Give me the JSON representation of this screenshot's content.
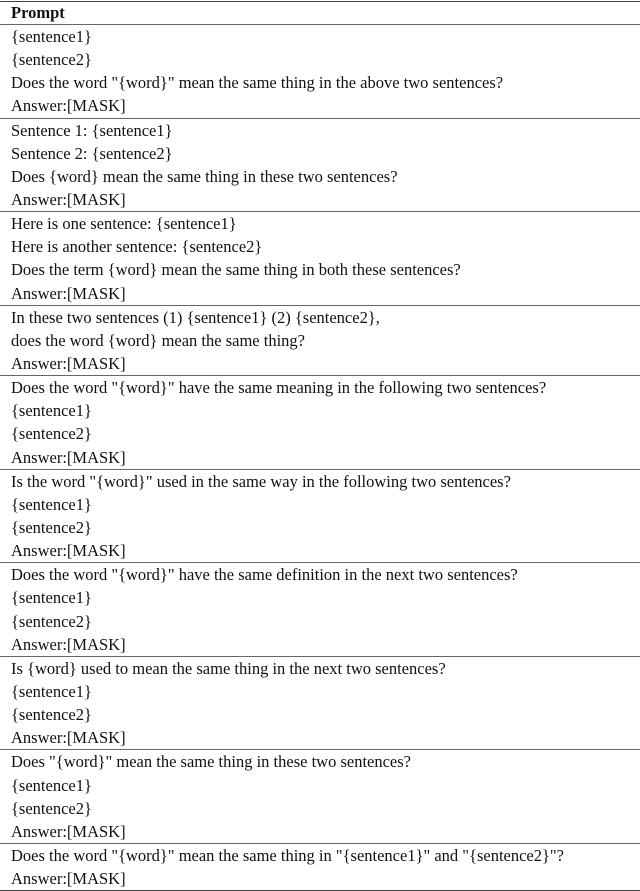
{
  "table": {
    "header": "Prompt",
    "groups": [
      {
        "lines": [
          "{sentence1}",
          "{sentence2}",
          "Does the word \"{word}\" mean the same thing in the above two sentences?",
          "Answer:[MASK]"
        ]
      },
      {
        "lines": [
          "Sentence 1: {sentence1}",
          "Sentence 2: {sentence2}",
          "Does {word} mean the same thing in these two sentences?",
          "Answer:[MASK]"
        ]
      },
      {
        "lines": [
          "Here is one sentence: {sentence1}",
          "Here is another sentence: {sentence2}",
          "Does the term {word} mean the same thing in both these sentences?",
          "Answer:[MASK]"
        ]
      },
      {
        "lines": [
          "In these two sentences (1) {sentence1} (2) {sentence2},",
          "does the word {word} mean the same thing?",
          "Answer:[MASK]"
        ]
      },
      {
        "lines": [
          "Does the word \"{word}\" have the same meaning in the following two sentences?",
          "{sentence1}",
          "{sentence2}",
          "Answer:[MASK]"
        ]
      },
      {
        "lines": [
          "Is the word \"{word}\" used in the same way in the following two sentences?",
          "{sentence1}",
          "{sentence2}",
          "Answer:[MASK]"
        ]
      },
      {
        "lines": [
          "Does the word \"{word}\" have the same definition in the next two sentences?",
          "{sentence1}",
          "{sentence2}",
          "Answer:[MASK]"
        ]
      },
      {
        "lines": [
          "Is {word} used to mean the same thing in the next two sentences?",
          "{sentence1}",
          "{sentence2}",
          "Answer:[MASK]"
        ]
      },
      {
        "lines": [
          "Does \"{word}\" mean the same thing in these two sentences?",
          "{sentence1}",
          "{sentence2}",
          "Answer:[MASK]"
        ]
      },
      {
        "lines": [
          "Does the word \"{word}\" mean the same thing in \"{sentence1}\" and \"{sentence2}\"?",
          "Answer:[MASK]"
        ]
      }
    ]
  }
}
